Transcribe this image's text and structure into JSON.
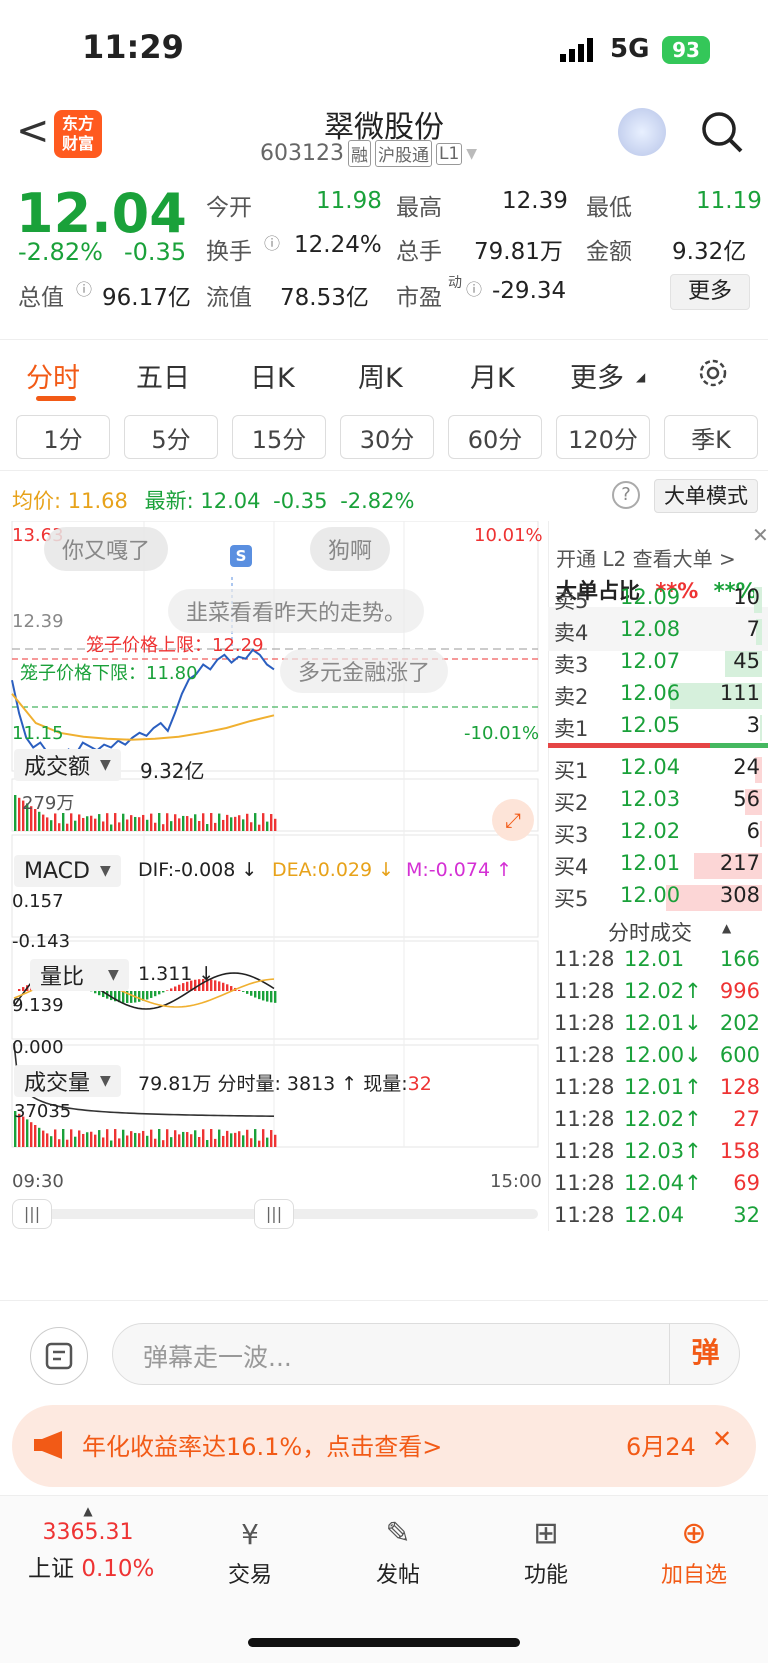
{
  "status": {
    "time": "11:29",
    "network": "5G",
    "battery": "93"
  },
  "header": {
    "back": "<",
    "logo": "东方\n财富",
    "logo_l1": "东方",
    "logo_l2": "财富",
    "name": "翠微股份",
    "code": "603123",
    "tags": [
      "融",
      "沪股通",
      "L1"
    ]
  },
  "quote": {
    "price": "12.04",
    "change_pct": "-2.82%",
    "change": "-0.35",
    "open_label": "今开",
    "open": "11.98",
    "high_label": "最高",
    "high": "12.39",
    "low_label": "最低",
    "low": "11.19",
    "turnover_label": "换手",
    "turnover": "12.24%",
    "volume_label": "总手",
    "volume": "79.81万",
    "amount_label": "金额",
    "amount": "9.32亿",
    "mktcap_label": "总值",
    "mktcap": "96.17亿",
    "float_label": "流值",
    "float": "78.53亿",
    "pe_label": "市盈",
    "pe_sup": "动",
    "pe": "-29.34",
    "more": "更多"
  },
  "tabs": [
    "分时",
    "五日",
    "日K",
    "周K",
    "月K",
    "更多"
  ],
  "periods": [
    "1分",
    "5分",
    "15分",
    "30分",
    "60分",
    "120分",
    "季K"
  ],
  "info": {
    "avg_label": "均价:",
    "avg": "11.68",
    "latest_label": "最新:",
    "latest": "12.04",
    "chg": "-0.35",
    "pct": "-2.82%",
    "mode": "大单模式"
  },
  "chart": {
    "ymax": "13.63",
    "ymin": "11.15",
    "pmax": "10.01%",
    "pmin": "-10.01%",
    "ref": "12.39",
    "upper": "笼子价格上限：12.29",
    "lower": "笼子价格下限：11.80",
    "danmu": [
      "你又嘎了",
      "狗啊",
      "韭菜看看昨天的走势。",
      "多元金融涨了"
    ],
    "s_badge": "S",
    "amount_label": "成交额",
    "amount_val": "9.32亿",
    "amount_max": "279万",
    "macd_label": "MACD",
    "dif": "DIF:-0.008 ↓",
    "dea": "DEA:0.029 ↓",
    "m": "M:-0.074 ↑",
    "macd_max": "0.157",
    "macd_min": "-0.143",
    "vr_label": "量比",
    "vr_val": "1.311 ↓",
    "vr_max": "9.139",
    "vr_min": "0.000",
    "vol_label": "成交量",
    "vol_val": "79.81万",
    "vol_time": "分时量: 3813 ↑",
    "vol_now_label": "现量:",
    "vol_now": "32",
    "vol_max": "37035",
    "t_start": "09:30",
    "t_end": "15:00"
  },
  "chart_data": {
    "type": "line",
    "title": "",
    "x": [
      "09:30",
      "15:00"
    ],
    "ylim": [
      11.15,
      13.63
    ],
    "series": [
      {
        "name": "最新",
        "values": [
          12.04
        ]
      },
      {
        "name": "均价",
        "values": [
          11.68
        ]
      }
    ]
  },
  "orderbook": {
    "l2": "开通 L2 查看大单 >",
    "ratio_label": "大单占比",
    "ratio_red": "**%",
    "ratio_green": "**%",
    "asks": [
      {
        "l": "卖5",
        "p": "12.09",
        "v": "10"
      },
      {
        "l": "卖4",
        "p": "12.08",
        "v": "7"
      },
      {
        "l": "卖3",
        "p": "12.07",
        "v": "45"
      },
      {
        "l": "卖2",
        "p": "12.06",
        "v": "111"
      },
      {
        "l": "卖1",
        "p": "12.05",
        "v": "3"
      }
    ],
    "bids": [
      {
        "l": "买1",
        "p": "12.04",
        "v": "24"
      },
      {
        "l": "买2",
        "p": "12.03",
        "v": "56"
      },
      {
        "l": "买3",
        "p": "12.02",
        "v": "6"
      },
      {
        "l": "买4",
        "p": "12.01",
        "v": "217"
      },
      {
        "l": "买5",
        "p": "12.00",
        "v": "308"
      }
    ],
    "ticks_label": "分时成交",
    "ticks": [
      {
        "t": "11:28",
        "p": "12.01",
        "v": "166"
      },
      {
        "t": "11:28",
        "p": "12.02↑",
        "v": "996"
      },
      {
        "t": "11:28",
        "p": "12.01↓",
        "v": "202"
      },
      {
        "t": "11:28",
        "p": "12.00↓",
        "v": "600"
      },
      {
        "t": "11:28",
        "p": "12.01↑",
        "v": "128"
      },
      {
        "t": "11:28",
        "p": "12.02↑",
        "v": "27"
      },
      {
        "t": "11:28",
        "p": "12.03↑",
        "v": "158"
      },
      {
        "t": "11:28",
        "p": "12.04↑",
        "v": "69"
      },
      {
        "t": "11:28",
        "p": "12.04",
        "v": "32"
      }
    ]
  },
  "danmu": {
    "placeholder": "弹幕走一波...",
    "send": "弹"
  },
  "ad": {
    "text": "年化收益率达16.1%，点击查看>",
    "date": "6月24",
    "close": "✕"
  },
  "nav": {
    "index_val": "3365.31",
    "index_name": "上证",
    "index_pct": "0.10%",
    "items": [
      "交易",
      "发帖",
      "功能",
      "加自选"
    ]
  }
}
